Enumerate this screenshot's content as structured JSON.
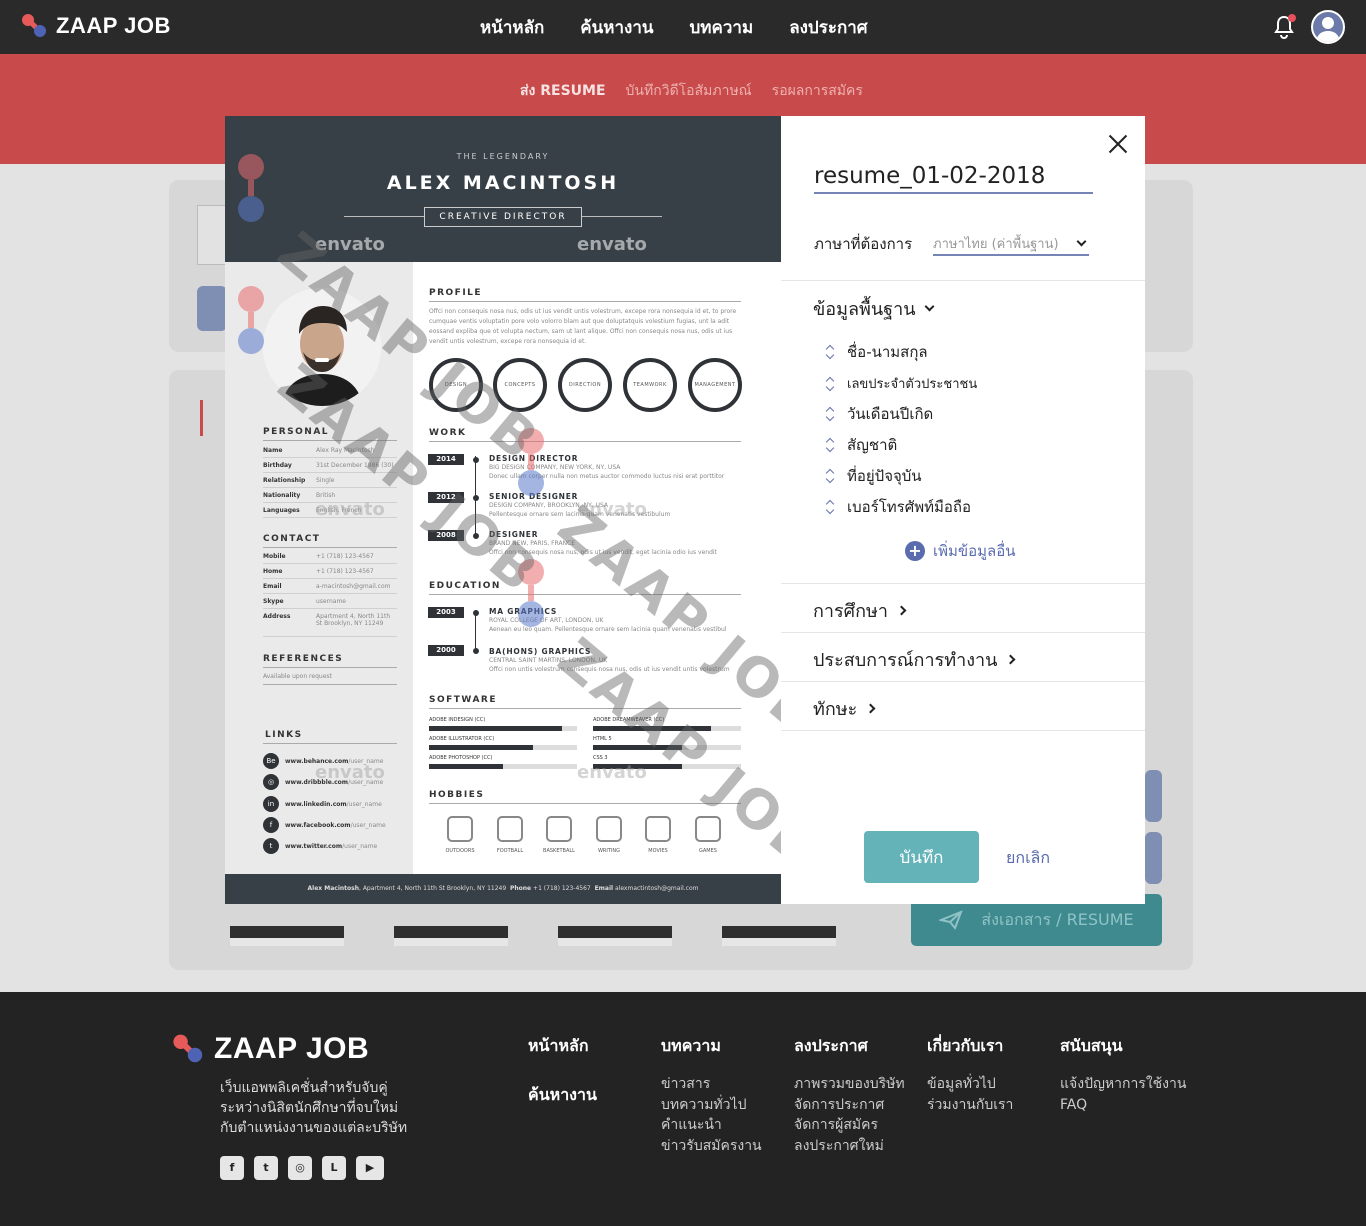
{
  "header": {
    "brand": "ZAAP JOB",
    "nav": [
      "หน้าหลัก",
      "ค้นหางาน",
      "บทความ",
      "ลงประกาศ"
    ]
  },
  "steps": [
    "ส่ง RESUME",
    "บันทึกวิดีโอสัมภาษณ์",
    "รอผลการสมัคร"
  ],
  "background": {
    "send_button": "ส่งเอกสาร / RESUME"
  },
  "resume": {
    "subtitle": "THE LEGENDARY",
    "name": "ALEX MACINTOSH",
    "role": "CREATIVE DIRECTOR",
    "watermark": "ZAAP JOB",
    "envato": "envato",
    "profile_title": "PROFILE",
    "profile_text": "Offci non consequis nosa nus, odis ut ius vendit untis volestrum, excepe rora nonsequia id et, to prore cumquae ventis voluptatin pore volo volorro blam aut que doluptatquis volestium fugias, unt la adit eossand expliba que ot volupta nectum, sam ut lant alique. Offci non consequis nosa nus, odis ut ius vendit untis volestrum, excepe rora nonsequia id et.",
    "skills_circle": [
      "DESIGN",
      "CONCEPTS",
      "DIRECTION",
      "TEAMWORK",
      "MANAGEMENT"
    ],
    "personal_title": "PERSONAL",
    "personal": [
      {
        "k": "Name",
        "v": "Alex Ray Macintosh"
      },
      {
        "k": "Birthday",
        "v": "31st December 1986 (30)"
      },
      {
        "k": "Relationship",
        "v": "Single"
      },
      {
        "k": "Nationality",
        "v": "British"
      },
      {
        "k": "Languages",
        "v": "English, French"
      }
    ],
    "contact_title": "CONTACT",
    "contact": [
      {
        "k": "Mobile",
        "v": "+1 (718) 123-4567"
      },
      {
        "k": "Home",
        "v": "+1 (718) 123-4567"
      },
      {
        "k": "Email",
        "v": "a-macintosh@gmail.com"
      },
      {
        "k": "Skype",
        "v": "username"
      },
      {
        "k": "Address",
        "v": "Apartment 4, North 11th St Brooklyn, NY 11249"
      }
    ],
    "references_title": "REFERENCES",
    "references_text": "Available upon request",
    "links_title": "LINKS",
    "links": [
      {
        "icon": "Be",
        "bold": "www.behance.com",
        "rest": "/user_name"
      },
      {
        "icon": "◎",
        "bold": "www.dribbble.com",
        "rest": "/user_name"
      },
      {
        "icon": "in",
        "bold": "www.linkedin.com",
        "rest": "/user_name"
      },
      {
        "icon": "f",
        "bold": "www.facebook.com",
        "rest": "/user_name"
      },
      {
        "icon": "t",
        "bold": "www.twitter.com",
        "rest": "/user_name"
      }
    ],
    "work_title": "WORK",
    "work": [
      {
        "year": "2014",
        "title": "DESIGN DIRECTOR",
        "place": "BIG DESIGN COMPANY, NEW YORK, NY, USA",
        "desc": "Donec ullam corper nulla non metus auctor commodo luctus nisi erat porttitor"
      },
      {
        "year": "2012",
        "title": "SENIOR DESIGNER",
        "place": "DESIGN COMPANY, BROOKLYN, NY, USA",
        "desc": "Pellentesque ornare sem lacinia quam venenatis vestibulum"
      },
      {
        "year": "2008",
        "title": "DESIGNER",
        "place": "BRAND NEW, PARIS, FRANCE",
        "desc": "Offci non consequis nosa nus, odis ut ius vendit, eget lacinia odio ius vendit"
      }
    ],
    "education_title": "EDUCATION",
    "education": [
      {
        "year": "2003",
        "title": "MA GRAPHICS",
        "place": "ROYAL COLLEGE OF ART, LONDON, UK",
        "desc": "Aenean eu leo quam. Pellentesque ornare sem lacinia quam venenatis vestibul"
      },
      {
        "year": "2000",
        "title": "BA(HONS) GRAPHICS",
        "place": "CENTRAL SAINT MARTINS, LONDON, UK",
        "desc": "Offci non untis volestrum consequis nosa nus, odis ut ius vendit untis volestrum"
      }
    ],
    "software_title": "SOFTWARE",
    "software": [
      {
        "name": "ADOBE INDESIGN (CC)",
        "level": 0.9
      },
      {
        "name": "ADOBE DREAMWEAVER (CC)",
        "level": 0.8
      },
      {
        "name": "ADOBE ILLUSTRATOR (CC)",
        "level": 0.7
      },
      {
        "name": "HTML 5",
        "level": 0.6
      },
      {
        "name": "ADOBE PHOTOSHOP (CC)",
        "level": 0.5
      },
      {
        "name": "CSS 3",
        "level": 0.6
      }
    ],
    "hobbies_title": "HOBBIES",
    "hobbies": [
      "OUTDOORS",
      "FOOTBALL",
      "BASKETBALL",
      "WRITING",
      "MOVIES",
      "GAMES"
    ],
    "footer": {
      "name": "Alex Macintosh",
      "address": "Apartment 4, North 11th St Brooklyn, NY 11249",
      "phone_label": "Phone",
      "phone": "+1 (718) 123-4567",
      "email_label": "Email",
      "email": "alexmactintosh@gmail.com"
    }
  },
  "panel": {
    "filename": "resume_01-02-2018",
    "language_label": "ภาษาที่ต้องการ",
    "language_value": "ภาษาไทย (ค่าพื้นฐาน)",
    "basic_info": "ข้อมูลพื้นฐาน",
    "fields": [
      "ชื่อ-นามสกุล",
      "เลขประจำตัวประชาชน",
      "วันเดือนปีเกิด",
      "สัญชาติ",
      "ที่อยู่ปัจจุบัน",
      "เบอร์โทรศัพท์มือถือ"
    ],
    "add_more": "เพิ่มข้อมูลอื่น",
    "education": "การศึกษา",
    "experience": "ประสบการณ์การทำงาน",
    "skills": "ทักษะ",
    "save": "บันทึก",
    "cancel": "ยกเลิก"
  },
  "footer": {
    "brand": "ZAAP JOB",
    "desc": "เว็บแอพพลิเคชั่นสำหรับจับคู่ ระหว่างนิสิตนักศึกษาที่จบใหม่ กับตำแหน่งงานของแต่ละบริษัท",
    "links": [
      "หน้าหลัก",
      "ค้นหางาน"
    ],
    "columns": [
      {
        "title": "บทความ",
        "items": [
          "ข่าวสาร",
          "บทความทั่วไป",
          "คำแนะนำ",
          "ข่าวรับสมัครงาน"
        ]
      },
      {
        "title": "ลงประกาศ",
        "items": [
          "ภาพรวมของบริษัท",
          "จัดการประกาศ",
          "จัดการผู้สมัคร",
          "ลงประกาศใหม่"
        ]
      },
      {
        "title": "เกี่ยวกับเรา",
        "items": [
          "ข้อมูลทั่วไป",
          "ร่วมงานกับเรา"
        ]
      },
      {
        "title": "สนับสนุน",
        "items": [
          "แจ้งปัญหาการใช้งาน",
          "FAQ"
        ]
      }
    ],
    "social": [
      "facebook-icon",
      "twitter-icon",
      "instagram-icon",
      "line-icon",
      "youtube-icon"
    ]
  }
}
